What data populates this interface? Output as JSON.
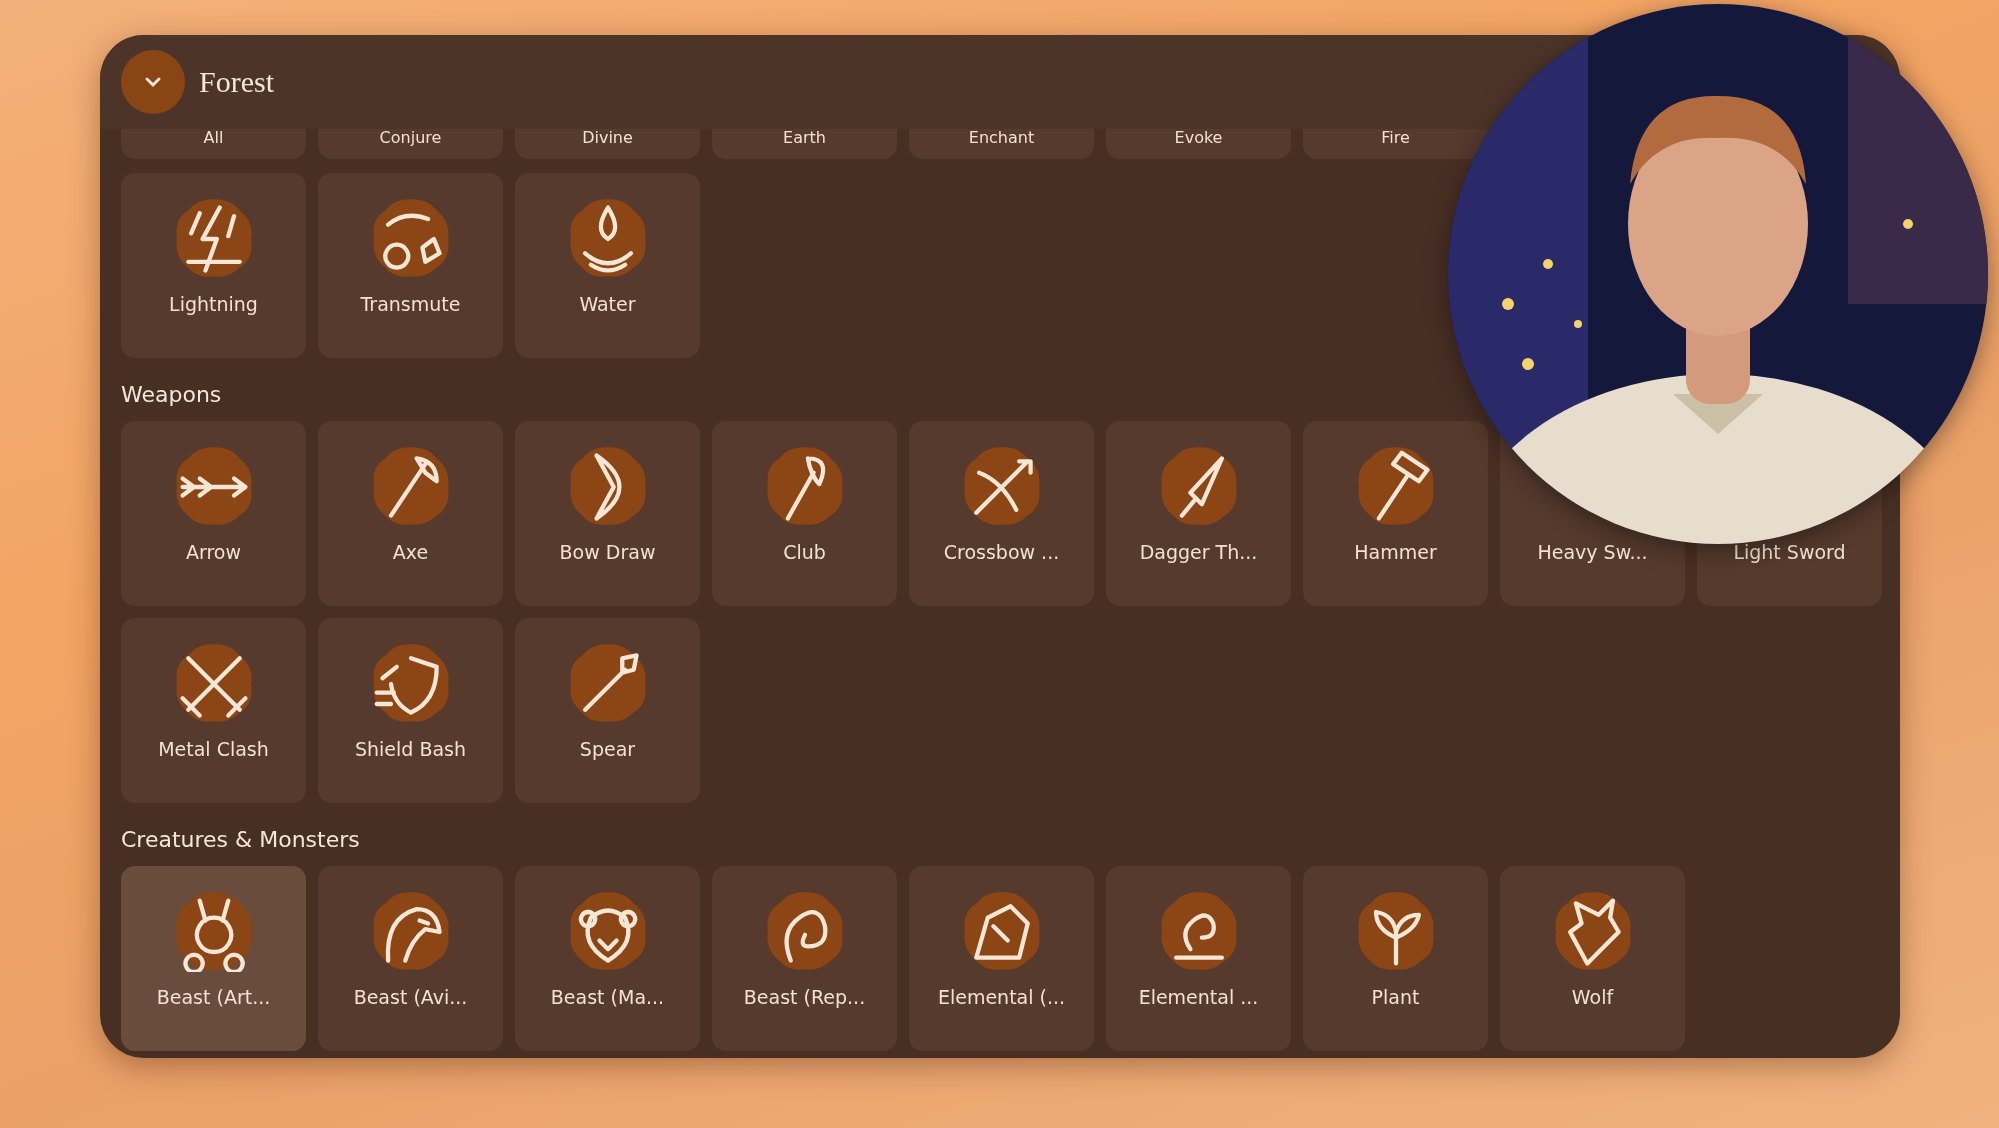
{
  "header": {
    "title": "Forest"
  },
  "top_row": [
    "All",
    "Conjure",
    "Divine",
    "Earth",
    "Enchant",
    "Evoke",
    "Fire"
  ],
  "sections": [
    {
      "items": [
        {
          "label": "Lightning",
          "selected": false
        },
        {
          "label": "Transmute",
          "selected": false
        },
        {
          "label": "Water",
          "selected": false
        }
      ]
    },
    {
      "title": "Weapons",
      "items": [
        {
          "label": "Arrow",
          "selected": false
        },
        {
          "label": "Axe",
          "selected": false
        },
        {
          "label": "Bow Draw",
          "selected": false
        },
        {
          "label": "Club",
          "selected": false
        },
        {
          "label": "Crossbow ...",
          "selected": false
        },
        {
          "label": "Dagger Th...",
          "selected": false
        },
        {
          "label": "Hammer",
          "selected": false
        },
        {
          "label": "Heavy Sw...",
          "selected": false
        },
        {
          "label": "Light Sword",
          "selected": false
        },
        {
          "label": "Metal Clash",
          "selected": false
        },
        {
          "label": "Shield Bash",
          "selected": false
        },
        {
          "label": "Spear",
          "selected": false
        }
      ]
    },
    {
      "title": "Creatures & Monsters",
      "items": [
        {
          "label": "Beast (Art...",
          "selected": true
        },
        {
          "label": "Beast (Avi...",
          "selected": false
        },
        {
          "label": "Beast (Ma...",
          "selected": false
        },
        {
          "label": "Beast (Rep...",
          "selected": false
        },
        {
          "label": "Elemental (...",
          "selected": false
        },
        {
          "label": "Elemental ...",
          "selected": false
        },
        {
          "label": "Plant",
          "selected": false
        },
        {
          "label": "Wolf",
          "selected": false
        }
      ]
    }
  ],
  "webcam": {
    "kind": "picture"
  }
}
